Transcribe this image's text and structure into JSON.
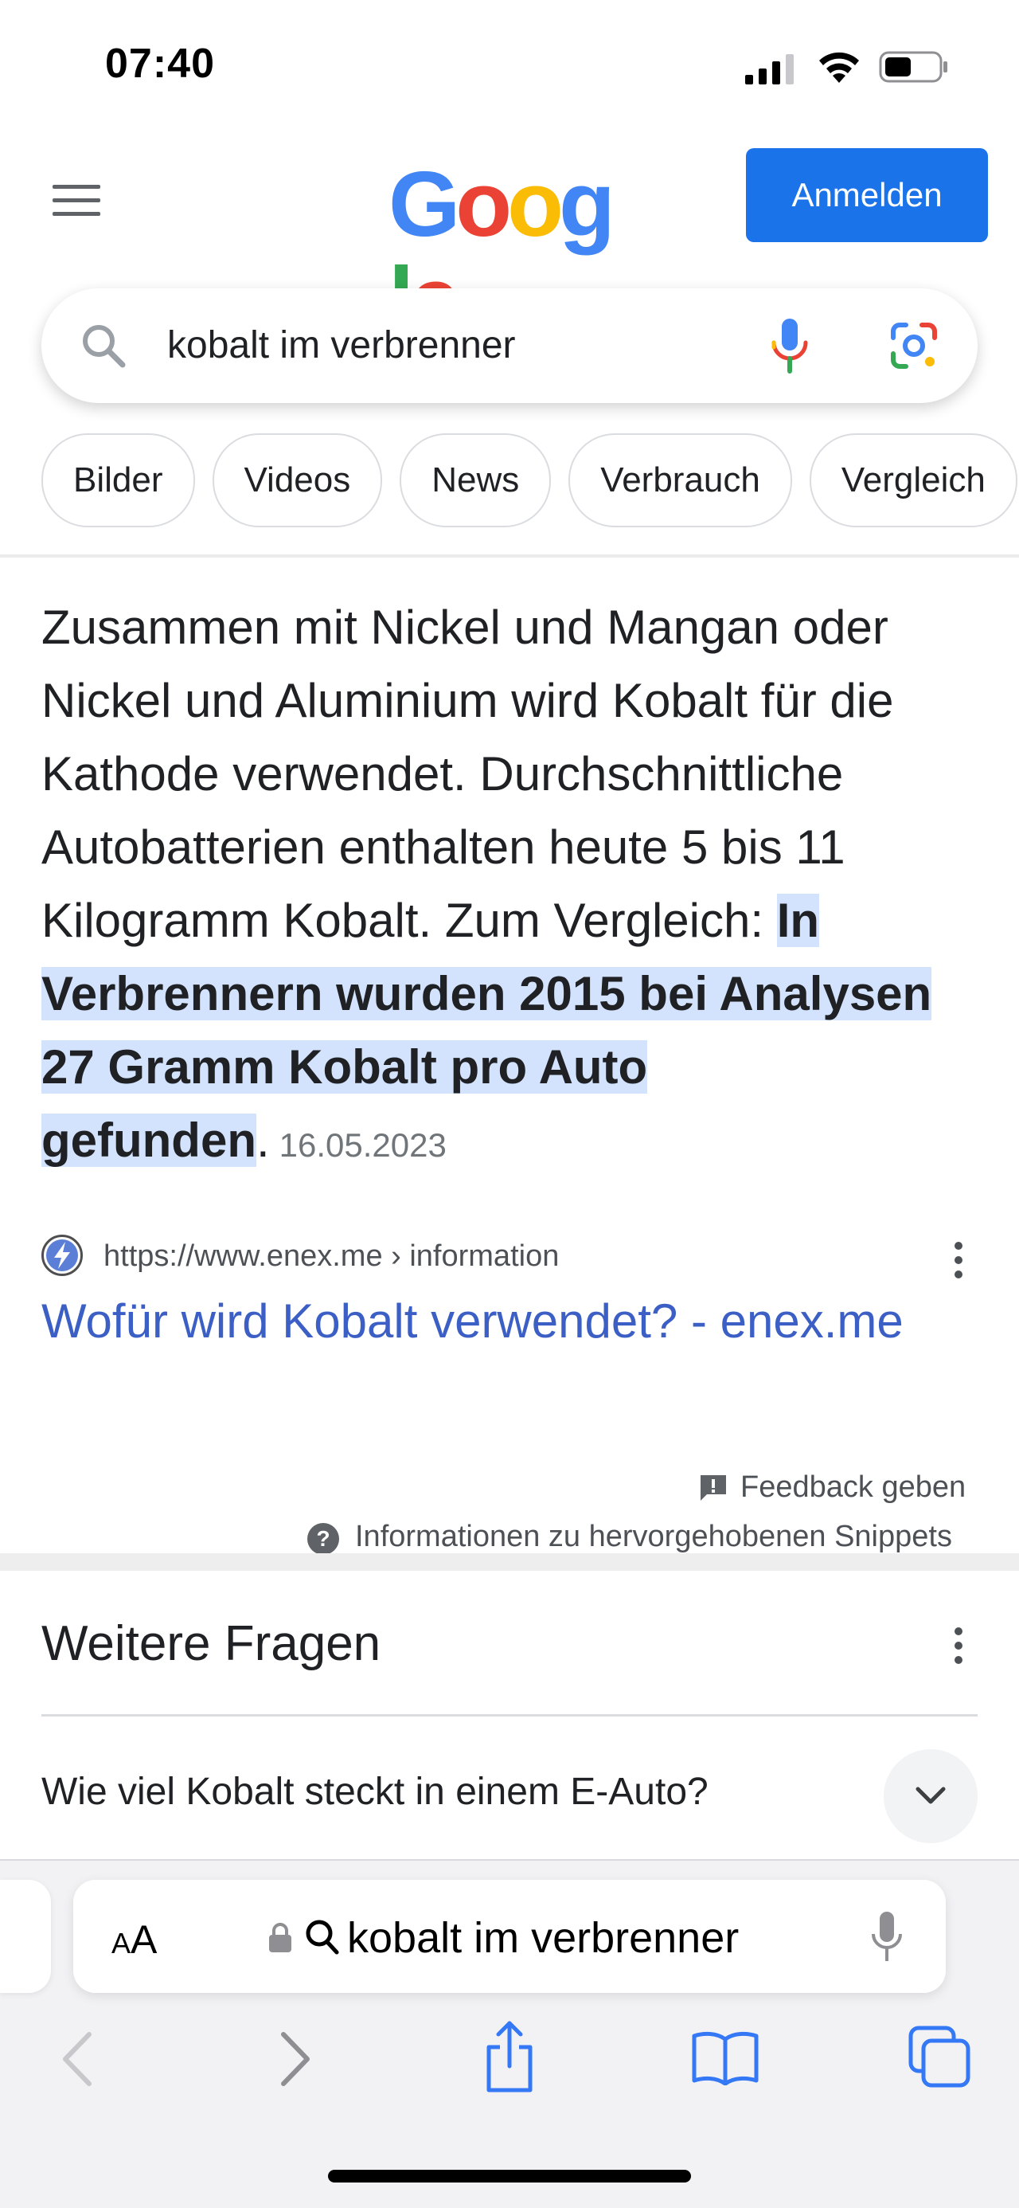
{
  "status_bar": {
    "time": "07:40"
  },
  "header": {
    "logo_letters": [
      {
        "ch": "G",
        "color": "#4285F4"
      },
      {
        "ch": "o",
        "color": "#EA4335"
      },
      {
        "ch": "o",
        "color": "#FBBC05"
      },
      {
        "ch": "g",
        "color": "#4285F4"
      },
      {
        "ch": "l",
        "color": "#34A853"
      },
      {
        "ch": "e",
        "color": "#EA4335"
      }
    ],
    "signin_label": "Anmelden"
  },
  "search": {
    "query": "kobalt im verbrenner"
  },
  "chips": [
    "Bilder",
    "Videos",
    "News",
    "Verbrauch",
    "Vergleich"
  ],
  "snippet": {
    "text_plain": "Zusammen mit Nickel und Mangan oder Nickel und Aluminium wird Kobalt für die Kathode verwendet. Durchschnittliche Autobatterien enthalten heute 5 bis 11 Kilogramm Kobalt. Zum Vergleich: ",
    "text_highlight": "In Verbrennern wurden 2015 bei Analysen 27 Gramm Kobalt pro Auto gefunden",
    "text_end": ".",
    "date": "16.05.2023",
    "source_url": "https://www.enex.me › information",
    "result_title": "Wofür wird Kobalt verwendet? - enex.me",
    "feedback_label": "Feedback geben",
    "info_label": "Informationen zu hervorgehobenen Snippets"
  },
  "more_questions": {
    "title": "Weitere Fragen",
    "items": [
      "Wie viel Kobalt steckt in einem E-Auto?"
    ]
  },
  "safari": {
    "text_size_label": "AA",
    "address_text": "kobalt im verbrenner"
  },
  "colors": {
    "accent": "#1a73e8",
    "highlight": "#d3e3fd",
    "link": "#3b5fc4",
    "safari_icon": "#3478f6"
  }
}
